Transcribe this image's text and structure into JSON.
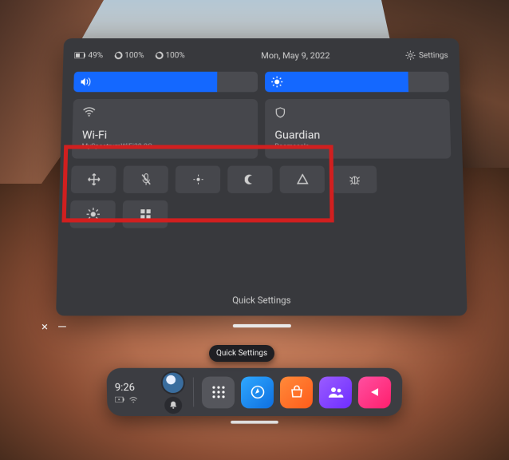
{
  "status": {
    "battery": "49%",
    "left_controller": "100%",
    "right_controller": "100%",
    "date": "Mon, May 9, 2022",
    "settings_label": "Settings"
  },
  "sliders": {
    "volume_value": 78,
    "brightness_value": 78
  },
  "cards": {
    "wifi": {
      "title": "Wi-Fi",
      "subtitle": "MySpectrumWiFi38-2G"
    },
    "guardian": {
      "title": "Guardian",
      "subtitle": "Roomscale"
    }
  },
  "buttons": {
    "recenter": "recenter",
    "mic_mute": "mic-mute",
    "low_brightness": "low-brightness",
    "night": "night",
    "passthrough": "passthrough",
    "bug": "bug-report",
    "full_brightness": "full-brightness",
    "apps_grid": "app-grid"
  },
  "panel_caption": "Quick Settings",
  "tooltip": "Quick Settings",
  "window_controls": {
    "close": "×",
    "minimize": "—"
  },
  "dock": {
    "time": "9:26",
    "apps": {
      "library": "App Library",
      "explore": "Explore",
      "store": "Store",
      "social": "People",
      "share": "Share"
    }
  }
}
